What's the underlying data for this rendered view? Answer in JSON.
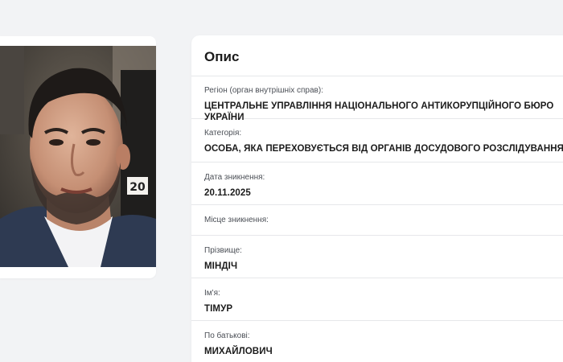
{
  "photo": {
    "badge_number": "20",
    "accent_color": "#ffffff"
  },
  "panel": {
    "title": "Опис",
    "fields": [
      {
        "label": "Регіон (орган внутрішніх справ):",
        "value": "ЦЕНТРАЛЬНЕ УПРАВЛІННЯ НАЦІОНАЛЬНОГО АНТИКОРУПЦІЙНОГО БЮРО УКРАЇНИ"
      },
      {
        "label": "Категорія:",
        "value": "ОСОБА, ЯКА ПЕРЕХОВУЄТЬСЯ ВІД ОРГАНІВ ДОСУДОВОГО РОЗСЛІДУВАННЯ"
      },
      {
        "label": "Дата зникнення:",
        "value": "20.11.2025"
      },
      {
        "label": "Місце зникнення:",
        "value": ""
      },
      {
        "label": "Прізвище:",
        "value": "МІНДІЧ"
      },
      {
        "label": "Ім'я:",
        "value": "ТІМУР"
      },
      {
        "label": "По батькові:",
        "value": "МИХАЙЛОВИЧ"
      }
    ]
  },
  "colors": {
    "page_background": "#f2f3f5",
    "card_background": "#ffffff",
    "divider": "#e6e7ea",
    "text": "#1b1b1b"
  }
}
